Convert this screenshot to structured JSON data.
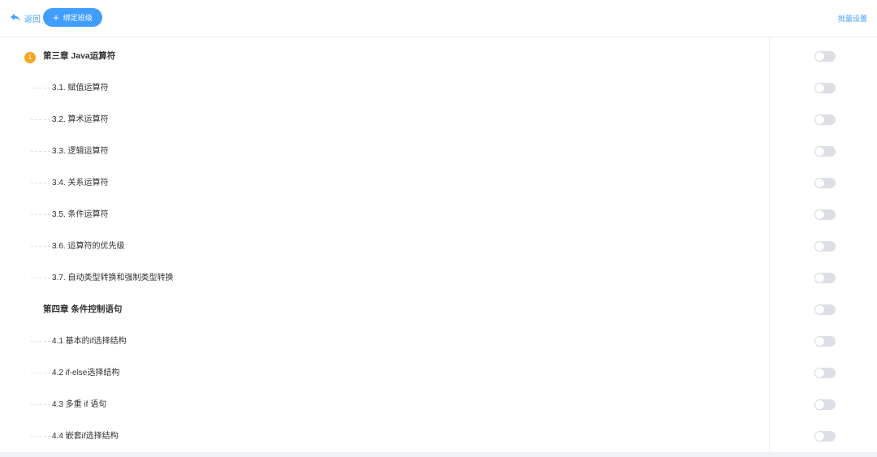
{
  "toolbar": {
    "back_label": "返回",
    "bind_button_label": "绑定班级",
    "bind_button_icon": "plus-icon",
    "batch_label": "批量设置"
  },
  "colors": {
    "accent": "#409eff",
    "badge": "#f5a623",
    "switch_off": "#dcdfe6"
  },
  "chapters": [
    {
      "badge": "1",
      "title": "第三章 Java运算符",
      "enabled": false,
      "sections": [
        {
          "title": "3.1. 赋值运算符",
          "enabled": false
        },
        {
          "title": "3.2. 算术运算符",
          "enabled": false
        },
        {
          "title": "3.3. 逻辑运算符",
          "enabled": false
        },
        {
          "title": "3.4. 关系运算符",
          "enabled": false
        },
        {
          "title": "3.5. 条件运算符",
          "enabled": false
        },
        {
          "title": "3.6. 运算符的优先级",
          "enabled": false
        },
        {
          "title": "3.7. 自动类型转换和强制类型转换",
          "enabled": false
        }
      ]
    },
    {
      "badge": "",
      "title": "第四章 条件控制语句",
      "enabled": false,
      "sections": [
        {
          "title": "4.1 基本的if选择结构",
          "enabled": false
        },
        {
          "title": "4.2 if-else选择结构",
          "enabled": false
        },
        {
          "title": "4.3 多重 if 语句",
          "enabled": false
        },
        {
          "title": "4.4 嵌套if选择结构",
          "enabled": false
        }
      ]
    }
  ]
}
